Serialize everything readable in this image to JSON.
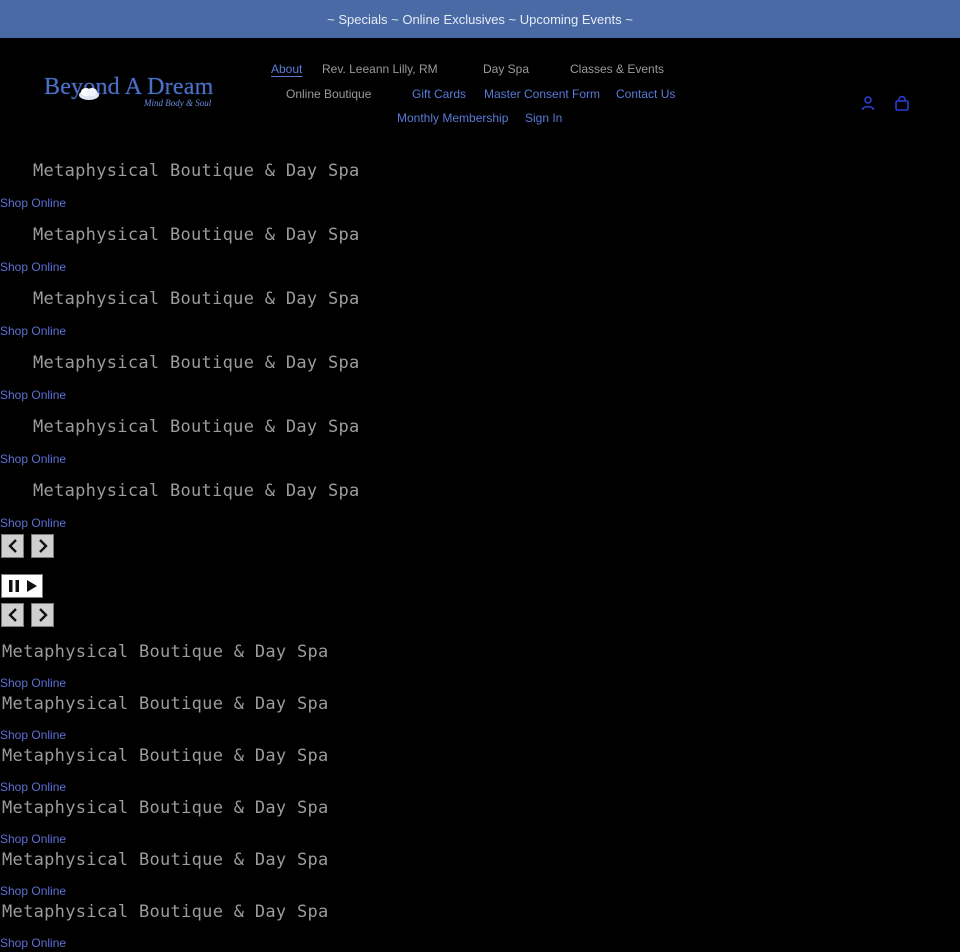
{
  "announcement": "~ Specials ~ Online Exclusives ~ Upcoming Events ~",
  "logo": {
    "name": "Beyond A Dream",
    "tagline": "Mind Body & Soul"
  },
  "nav": {
    "about": "About",
    "rev": "Rev. Leeann Lilly, RM",
    "day_spa": "Day Spa",
    "classes": "Classes & Events",
    "online_boutique": "Online Boutique",
    "gift_cards": "Gift Cards",
    "consent": "Master Consent Form",
    "contact": "Contact Us",
    "membership": "Monthly Membership",
    "sign_in": "Sign In"
  },
  "slideshow_primary": [
    {
      "title": "Metaphysical Boutique & Day Spa",
      "link": "Shop Online"
    },
    {
      "title": "Metaphysical Boutique & Day Spa",
      "link": "Shop Online"
    },
    {
      "title": "Metaphysical Boutique & Day Spa",
      "link": "Shop Online"
    },
    {
      "title": "Metaphysical Boutique & Day Spa",
      "link": "Shop Online"
    },
    {
      "title": "Metaphysical Boutique & Day Spa",
      "link": "Shop Online"
    },
    {
      "title": "Metaphysical Boutique & Day Spa",
      "link": "Shop Online"
    }
  ],
  "slideshow_secondary": [
    {
      "title": "Metaphysical Boutique & Day Spa",
      "link": "Shop Online"
    },
    {
      "title": "Metaphysical Boutique & Day Spa",
      "link": "Shop Online"
    },
    {
      "title": "Metaphysical Boutique & Day Spa",
      "link": "Shop Online"
    },
    {
      "title": "Metaphysical Boutique & Day Spa",
      "link": "Shop Online"
    },
    {
      "title": "Metaphysical Boutique & Day Spa",
      "link": "Shop Online"
    },
    {
      "title": "Metaphysical Boutique & Day Spa",
      "link": "Shop Online"
    }
  ],
  "colors": {
    "announcement_bg": "#4a6aa5",
    "page_bg": "#000000",
    "link_blue": "#5c70d8",
    "title_gray": "#9c9c9c",
    "nav_gray": "#9a9a9a"
  },
  "icons": {
    "account": "account-icon",
    "cart": "cart-icon",
    "prev": "chevron-left-icon",
    "next": "chevron-right-icon",
    "pause": "pause-icon",
    "play": "play-icon"
  }
}
